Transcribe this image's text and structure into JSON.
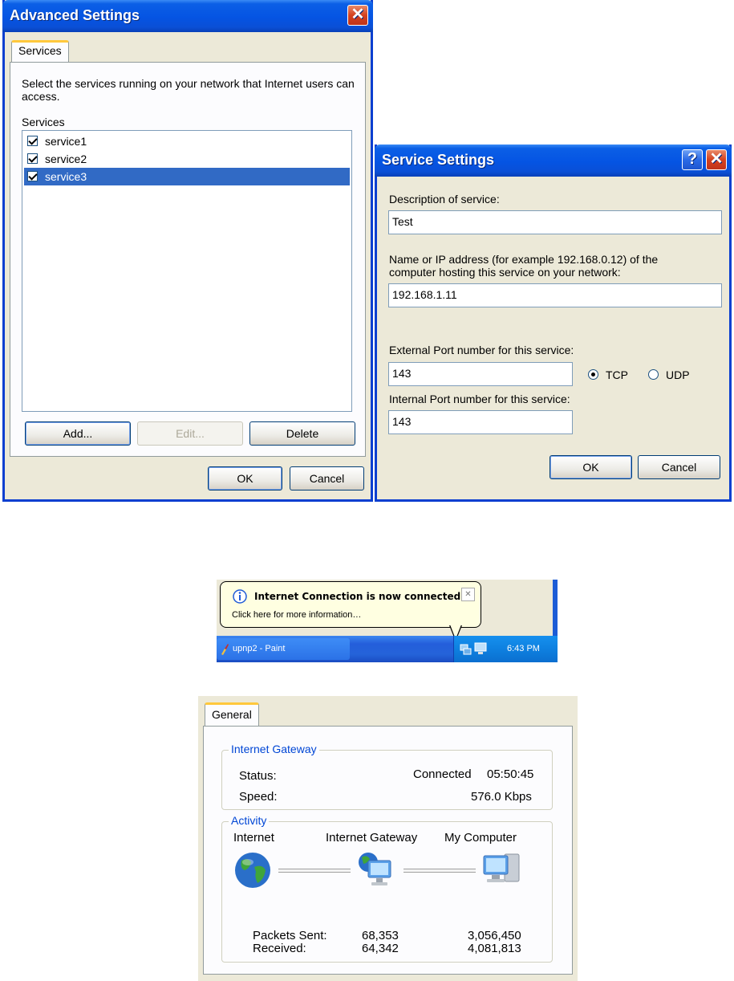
{
  "advanced_settings": {
    "title": "Advanced Settings",
    "close_glyph": "✕",
    "tab": "Services",
    "description": "Select the services running on your network that Internet users can access.",
    "list_label": "Services",
    "services": [
      {
        "label": "service1",
        "checked": true,
        "selected": false
      },
      {
        "label": "service2",
        "checked": true,
        "selected": false
      },
      {
        "label": "service3",
        "checked": true,
        "selected": true
      }
    ],
    "add_label": "Add...",
    "edit_label": "Edit...",
    "delete_label": "Delete",
    "ok_label": "OK",
    "cancel_label": "Cancel"
  },
  "service_settings": {
    "title": "Service Settings",
    "help_glyph": "?",
    "close_glyph": "✕",
    "description_label": "Description of service:",
    "description_value": "Test",
    "host_label_line1": "Name or IP address (for example 192.168.0.12) of the",
    "host_label_line2": "computer hosting this service on your network:",
    "host_value": "192.168.1.11",
    "external_port_label": "External Port number for this service:",
    "external_port_value": "143",
    "tcp_label": "TCP",
    "udp_label": "UDP",
    "protocol_selected": "TCP",
    "internal_port_label": "Internal Port number for this service:",
    "internal_port_value": "143",
    "ok_label": "OK",
    "cancel_label": "Cancel"
  },
  "notification": {
    "title": "Internet Connection is now connected",
    "message": "Click here for more information…",
    "close_glyph": "✕",
    "task_label": "upnp2 - Paint",
    "clock": "6:43 PM",
    "icon": "info-icon"
  },
  "status_panel": {
    "tab": "General",
    "gateway_group": "Internet Gateway",
    "status_label": "Status:",
    "status_value": "Connected",
    "duration": "05:50:45",
    "speed_label": "Speed:",
    "speed_value": "576.0 Kbps",
    "activity_group": "Activity",
    "nodes": [
      "Internet",
      "Internet Gateway",
      "My Computer"
    ],
    "packets_sent_label": "Packets Sent:",
    "received_label": "Received:",
    "gateway_sent": "68,353",
    "gateway_received": "64,342",
    "computer_sent": "3,056,450",
    "computer_received": "4,081,813"
  },
  "colors": {
    "xp_titlebar": "#0554e3",
    "selection": "#316ac5",
    "group_title": "#0046d5",
    "dialog_bg": "#ece9d8"
  }
}
